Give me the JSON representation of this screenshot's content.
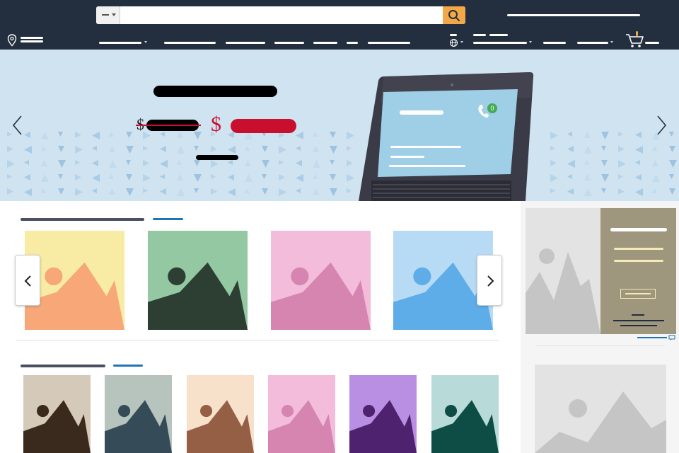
{
  "header": {
    "search": {
      "placeholder": "",
      "value": "",
      "category_icon": "dash-icon"
    },
    "search_icon": "search-icon",
    "location_icon": "location-pin-icon",
    "language_icon": "globe-icon",
    "cart": {
      "icon": "cart-icon",
      "count": "0"
    },
    "colors": {
      "background": "#232f3e",
      "search_button": "#f3a847"
    }
  },
  "hero": {
    "background": "#cfe3f1",
    "old_price_symbol": "$",
    "new_price_symbol": "$",
    "price_color": "#c8102e",
    "device": {
      "phone_icon": "phone-icon",
      "badge": "0"
    },
    "prev_icon": "chevron-left-icon",
    "next_icon": "chevron-right-icon"
  },
  "carousel_1": {
    "tiles": [
      {
        "bg": "#f8eba4",
        "mountain": "#f7a778",
        "sun": "#f7a778"
      },
      {
        "bg": "#93c8a3",
        "mountain": "#2d3f32",
        "sun": "#2d3f32"
      },
      {
        "bg": "#f2bcda",
        "mountain": "#d585b0",
        "sun": "#d585b0"
      },
      {
        "bg": "#b8dbf5",
        "mountain": "#5eade9",
        "sun": "#5eade9"
      }
    ]
  },
  "carousel_2": {
    "tiles": [
      {
        "bg": "#d5cab9",
        "mountain": "#3a2a1d",
        "sun": "#3a2a1d"
      },
      {
        "bg": "#b6c4bd",
        "mountain": "#364b58",
        "sun": "#364b58"
      },
      {
        "bg": "#f8e1cb",
        "mountain": "#955f46",
        "sun": "#955f46"
      },
      {
        "bg": "#f2bcda",
        "mountain": "#d585b0",
        "sun": "#d585b0"
      },
      {
        "bg": "#b88fe3",
        "mountain": "#4f2270",
        "sun": "#4f2270"
      },
      {
        "bg": "#b8dbd9",
        "mountain": "#0d4d46",
        "sun": "#0d4d46"
      }
    ]
  },
  "sidebar": {
    "ad_bg": "#9e967d",
    "ad_image_bg": "#e3e3e3",
    "feedback_icon": "speech-bubble-icon"
  }
}
